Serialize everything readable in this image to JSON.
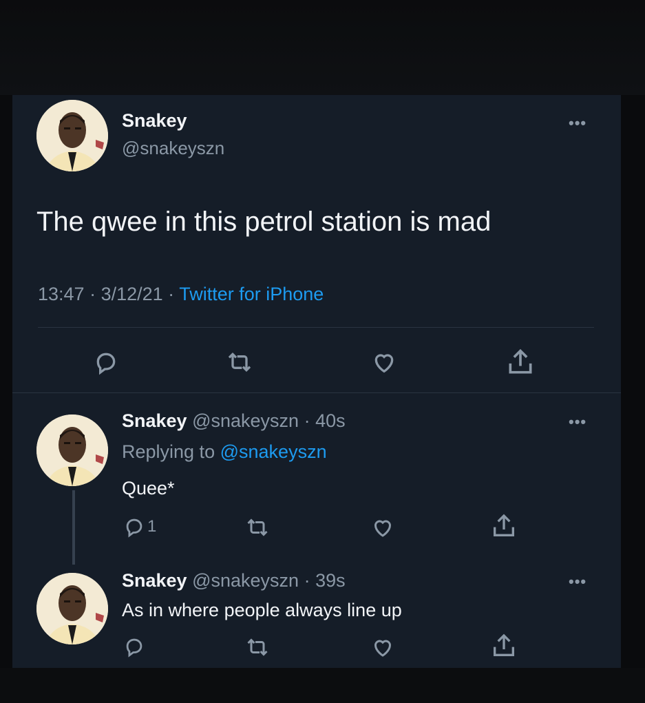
{
  "main_tweet": {
    "name": "Snakey",
    "handle": "@snakeyszn",
    "text": "The qwee in this petrol station is mad",
    "time": "13:47",
    "date": "3/12/21",
    "source": "Twitter for iPhone",
    "separator": " · "
  },
  "replies": [
    {
      "name": "Snakey",
      "handle": "@snakeyszn",
      "age": "40s",
      "replying_label": "Replying to",
      "replying_to": "@snakeyszn",
      "text": "Quee*",
      "reply_count": "1"
    },
    {
      "name": "Snakey",
      "handle": "@snakeyszn",
      "age": "39s",
      "text": "As in where people always line up"
    }
  ],
  "more_label": "•••",
  "icons": [
    "reply-icon",
    "retweet-icon",
    "like-icon",
    "share-icon",
    "more-icon"
  ],
  "colors": {
    "background": "#151d28",
    "text": "#f2f4f7",
    "secondary": "#8b98a6",
    "accent": "#1d9bf0"
  }
}
